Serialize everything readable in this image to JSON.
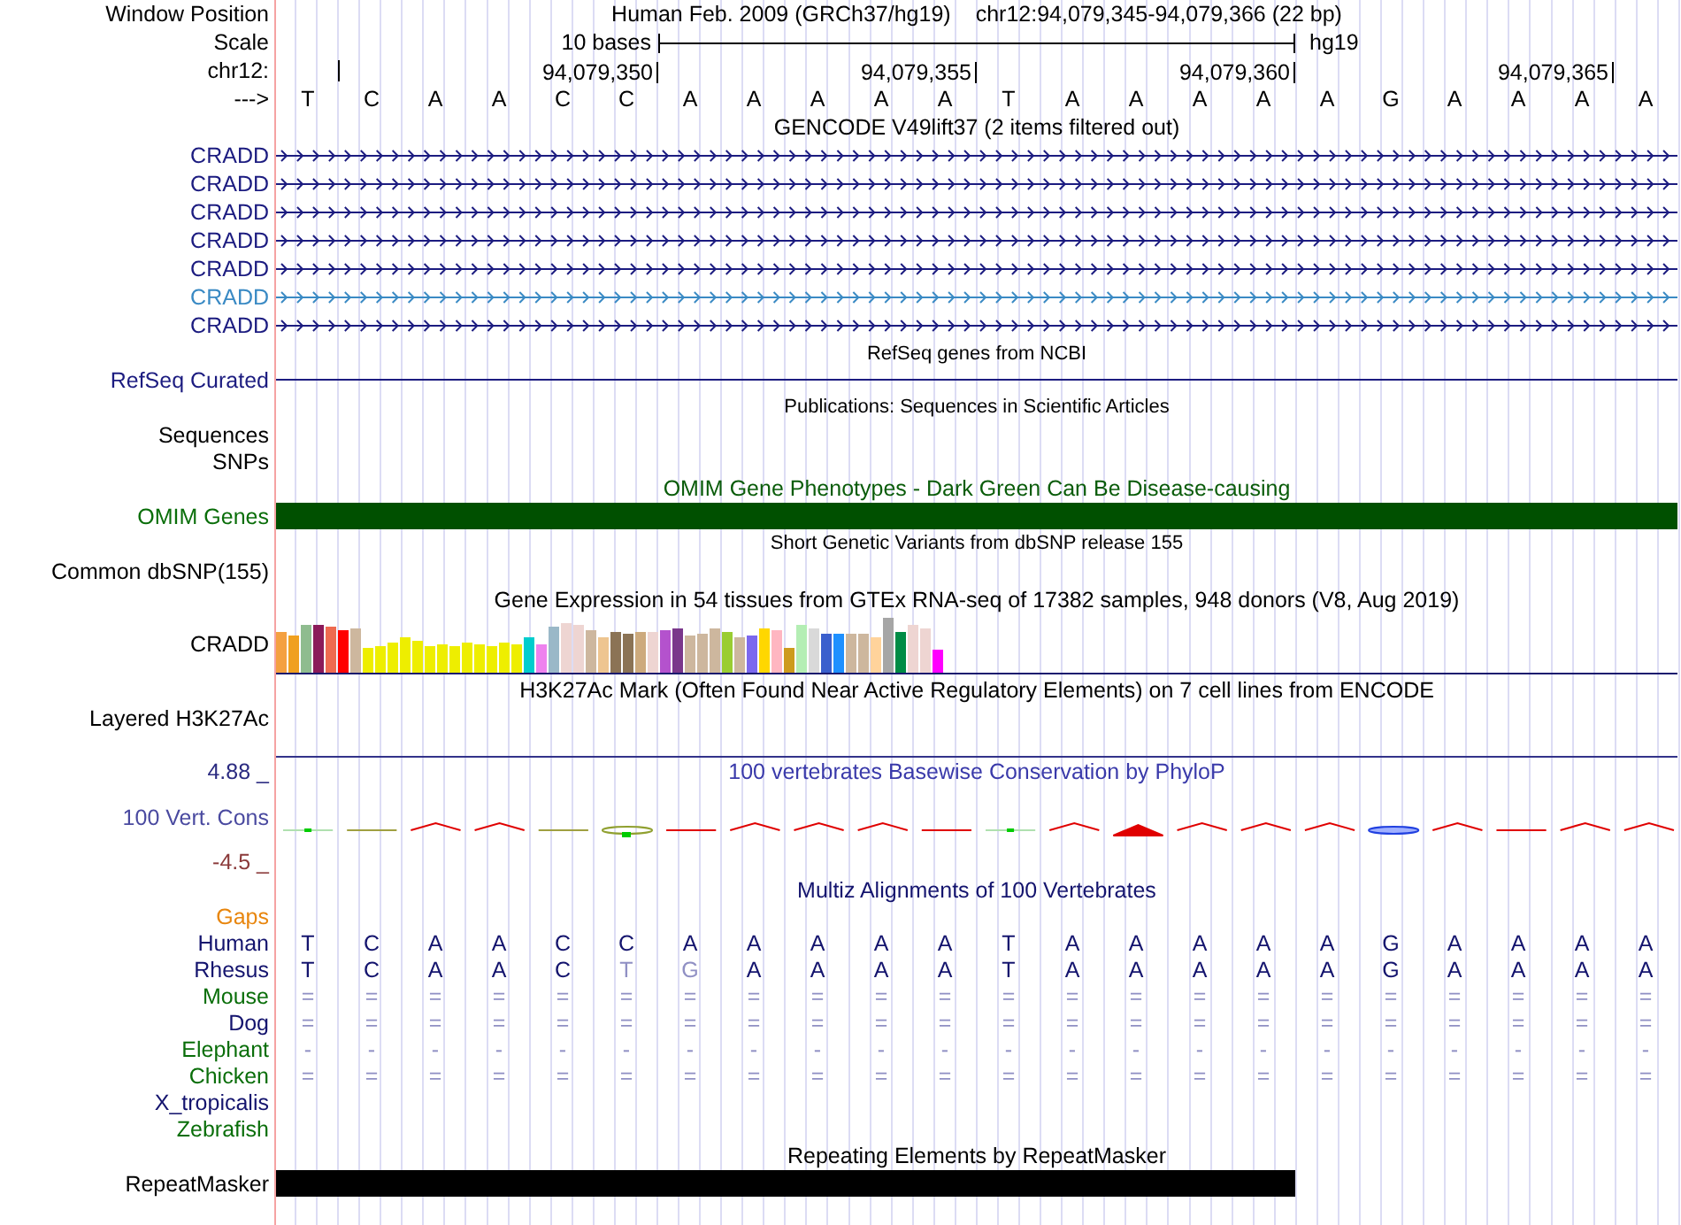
{
  "header": {
    "position_label": "Window Position",
    "assembly": "Human Feb. 2009 (GRCh37/hg19)",
    "range": "chr12:94,079,345-94,079,366 (22 bp)",
    "scale_label": "Scale",
    "scale_span": "10 bases",
    "scale_assembly": "hg19",
    "ruler_label": "chr12:",
    "ticks": [
      {
        "kind": "minor"
      },
      {
        "kind": "major",
        "label": "94,079,350"
      },
      {
        "kind": "major",
        "label": "94,079,355"
      },
      {
        "kind": "major",
        "label": "94,079,360"
      },
      {
        "kind": "major",
        "label": "94,079,365"
      }
    ],
    "strand_label": "--->",
    "bases": [
      "T",
      "C",
      "A",
      "A",
      "C",
      "C",
      "A",
      "A",
      "A",
      "A",
      "A",
      "T",
      "A",
      "A",
      "A",
      "A",
      "A",
      "G",
      "A",
      "A",
      "A",
      "A"
    ]
  },
  "tracks": [
    {
      "kind": "gene",
      "title": "GENCODE V49lift37 (2 items filtered out)",
      "items": [
        {
          "name": "CRADD",
          "color": "#1c1c80"
        },
        {
          "name": "CRADD",
          "color": "#1c1c80"
        },
        {
          "name": "CRADD",
          "color": "#1c1c80"
        },
        {
          "name": "CRADD",
          "color": "#1c1c80"
        },
        {
          "name": "CRADD",
          "color": "#1c1c80"
        },
        {
          "name": "CRADD",
          "color": "#3a8ac4"
        },
        {
          "name": "CRADD",
          "color": "#1c1c80"
        }
      ]
    },
    {
      "kind": "refseq",
      "title": "RefSeq genes from NCBI",
      "label": "RefSeq Curated"
    },
    {
      "kind": "publications",
      "title": "Publications: Sequences in Scientific Articles",
      "labels": [
        "Sequences",
        "SNPs"
      ]
    },
    {
      "kind": "omim",
      "title": "OMIM Gene Phenotypes - Dark Green Can Be Disease-causing",
      "label": "OMIM Genes"
    },
    {
      "kind": "dbsnp",
      "title": "Short Genetic Variants from dbSNP release 155",
      "label": "Common dbSNP(155)"
    },
    {
      "kind": "expression",
      "title": "Gene Expression in 54 tissues from GTEx RNA-seq of 17382 samples, 948 donors (V8, Aug 2019)",
      "label": "CRADD"
    },
    {
      "kind": "h3k27ac",
      "title": "H3K27Ac Mark (Often Found Near Active Regulatory Elements) on 7 cell lines from ENCODE",
      "label": "Layered H3K27Ac"
    },
    {
      "kind": "phylop",
      "title": "100 vertebrates Basewise Conservation by PhyloP",
      "label": "100 Vert. Cons",
      "max": "4.88 _",
      "min": "-4.5 _"
    },
    {
      "kind": "multiz",
      "title": "Multiz Alignments of 100 Vertebrates",
      "rows": [
        {
          "name": "Gaps",
          "color": "#e8860e"
        },
        {
          "name": "Human",
          "color": "#14146e",
          "bases": [
            {
              "base": "T",
              "dim": false
            },
            {
              "base": "C",
              "dim": false
            },
            {
              "base": "A",
              "dim": false
            },
            {
              "base": "A",
              "dim": false
            },
            {
              "base": "C",
              "dim": false
            },
            {
              "base": "C",
              "dim": false
            },
            {
              "base": "A",
              "dim": false
            },
            {
              "base": "A",
              "dim": false
            },
            {
              "base": "A",
              "dim": false
            },
            {
              "base": "A",
              "dim": false
            },
            {
              "base": "A",
              "dim": false
            },
            {
              "base": "T",
              "dim": false
            },
            {
              "base": "A",
              "dim": false
            },
            {
              "base": "A",
              "dim": false
            },
            {
              "base": "A",
              "dim": false
            },
            {
              "base": "A",
              "dim": false
            },
            {
              "base": "A",
              "dim": false
            },
            {
              "base": "G",
              "dim": false
            },
            {
              "base": "A",
              "dim": false
            },
            {
              "base": "A",
              "dim": false
            },
            {
              "base": "A",
              "dim": false
            },
            {
              "base": "A",
              "dim": false
            }
          ]
        },
        {
          "name": "Rhesus",
          "color": "#14146e",
          "bases": [
            {
              "base": "T",
              "dim": false
            },
            {
              "base": "C",
              "dim": false
            },
            {
              "base": "A",
              "dim": false
            },
            {
              "base": "A",
              "dim": false
            },
            {
              "base": "C",
              "dim": false
            },
            {
              "base": "T",
              "dim": true
            },
            {
              "base": "G",
              "dim": true
            },
            {
              "base": "A",
              "dim": false
            },
            {
              "base": "A",
              "dim": false
            },
            {
              "base": "A",
              "dim": false
            },
            {
              "base": "A",
              "dim": false
            },
            {
              "base": "T",
              "dim": false
            },
            {
              "base": "A",
              "dim": false
            },
            {
              "base": "A",
              "dim": false
            },
            {
              "base": "A",
              "dim": false
            },
            {
              "base": "A",
              "dim": false
            },
            {
              "base": "A",
              "dim": false
            },
            {
              "base": "G",
              "dim": false
            },
            {
              "base": "A",
              "dim": false
            },
            {
              "base": "A",
              "dim": false
            },
            {
              "base": "A",
              "dim": false
            },
            {
              "base": "A",
              "dim": false
            }
          ]
        },
        {
          "name": "Mouse",
          "color": "#0a6e0a",
          "bases": [
            {
              "base": "=",
              "dim": true
            },
            {
              "base": "=",
              "dim": true
            },
            {
              "base": "=",
              "dim": true
            },
            {
              "base": "=",
              "dim": true
            },
            {
              "base": "=",
              "dim": true
            },
            {
              "base": "=",
              "dim": true
            },
            {
              "base": "=",
              "dim": true
            },
            {
              "base": "=",
              "dim": true
            },
            {
              "base": "=",
              "dim": true
            },
            {
              "base": "=",
              "dim": true
            },
            {
              "base": "=",
              "dim": true
            },
            {
              "base": "=",
              "dim": true
            },
            {
              "base": "=",
              "dim": true
            },
            {
              "base": "=",
              "dim": true
            },
            {
              "base": "=",
              "dim": true
            },
            {
              "base": "=",
              "dim": true
            },
            {
              "base": "=",
              "dim": true
            },
            {
              "base": "=",
              "dim": true
            },
            {
              "base": "=",
              "dim": true
            },
            {
              "base": "=",
              "dim": true
            },
            {
              "base": "=",
              "dim": true
            },
            {
              "base": "=",
              "dim": true
            }
          ]
        },
        {
          "name": "Dog",
          "color": "#14146e",
          "bases": [
            {
              "base": "=",
              "dim": true
            },
            {
              "base": "=",
              "dim": true
            },
            {
              "base": "=",
              "dim": true
            },
            {
              "base": "=",
              "dim": true
            },
            {
              "base": "=",
              "dim": true
            },
            {
              "base": "=",
              "dim": true
            },
            {
              "base": "=",
              "dim": true
            },
            {
              "base": "=",
              "dim": true
            },
            {
              "base": "=",
              "dim": true
            },
            {
              "base": "=",
              "dim": true
            },
            {
              "base": "=",
              "dim": true
            },
            {
              "base": "=",
              "dim": true
            },
            {
              "base": "=",
              "dim": true
            },
            {
              "base": "=",
              "dim": true
            },
            {
              "base": "=",
              "dim": true
            },
            {
              "base": "=",
              "dim": true
            },
            {
              "base": "=",
              "dim": true
            },
            {
              "base": "=",
              "dim": true
            },
            {
              "base": "=",
              "dim": true
            },
            {
              "base": "=",
              "dim": true
            },
            {
              "base": "=",
              "dim": true
            },
            {
              "base": "=",
              "dim": true
            }
          ]
        },
        {
          "name": "Elephant",
          "color": "#0a6e0a",
          "bases": [
            {
              "base": "-",
              "dim": true
            },
            {
              "base": "-",
              "dim": true
            },
            {
              "base": "-",
              "dim": true
            },
            {
              "base": "-",
              "dim": true
            },
            {
              "base": "-",
              "dim": true
            },
            {
              "base": "-",
              "dim": true
            },
            {
              "base": "-",
              "dim": true
            },
            {
              "base": "-",
              "dim": true
            },
            {
              "base": "-",
              "dim": true
            },
            {
              "base": "-",
              "dim": true
            },
            {
              "base": "-",
              "dim": true
            },
            {
              "base": "-",
              "dim": true
            },
            {
              "base": "-",
              "dim": true
            },
            {
              "base": "-",
              "dim": true
            },
            {
              "base": "-",
              "dim": true
            },
            {
              "base": "-",
              "dim": true
            },
            {
              "base": "-",
              "dim": true
            },
            {
              "base": "-",
              "dim": true
            },
            {
              "base": "-",
              "dim": true
            },
            {
              "base": "-",
              "dim": true
            },
            {
              "base": "-",
              "dim": true
            },
            {
              "base": "-",
              "dim": true
            }
          ]
        },
        {
          "name": "Chicken",
          "color": "#0a6e0a",
          "bases": [
            {
              "base": "=",
              "dim": true
            },
            {
              "base": "=",
              "dim": true
            },
            {
              "base": "=",
              "dim": true
            },
            {
              "base": "=",
              "dim": true
            },
            {
              "base": "=",
              "dim": true
            },
            {
              "base": "=",
              "dim": true
            },
            {
              "base": "=",
              "dim": true
            },
            {
              "base": "=",
              "dim": true
            },
            {
              "base": "=",
              "dim": true
            },
            {
              "base": "=",
              "dim": true
            },
            {
              "base": "=",
              "dim": true
            },
            {
              "base": "=",
              "dim": true
            },
            {
              "base": "=",
              "dim": true
            },
            {
              "base": "=",
              "dim": true
            },
            {
              "base": "=",
              "dim": true
            },
            {
              "base": "=",
              "dim": true
            },
            {
              "base": "=",
              "dim": true
            },
            {
              "base": "=",
              "dim": true
            },
            {
              "base": "=",
              "dim": true
            },
            {
              "base": "=",
              "dim": true
            },
            {
              "base": "=",
              "dim": true
            },
            {
              "base": "=",
              "dim": true
            }
          ]
        },
        {
          "name": "X_tropicalis",
          "color": "#14146e"
        },
        {
          "name": "Zebrafish",
          "color": "#0a6e0a"
        }
      ]
    },
    {
      "kind": "repeat",
      "title": "Repeating Elements by RepeatMasker",
      "label": "RepeatMasker"
    }
  ]
}
